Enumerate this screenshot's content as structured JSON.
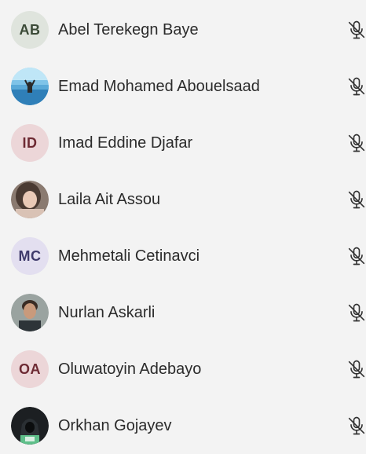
{
  "participants": [
    {
      "name": "Abel Terekegn Baye",
      "initials": "AB",
      "avatar_type": "initials",
      "avatar_bg": "#dfe4dd",
      "avatar_fg": "#3b4a37",
      "mic_state": "muted"
    },
    {
      "name": "Emad Mohamed Abouelsaad",
      "avatar_type": "photo",
      "photo_desc": "beach-photo",
      "mic_state": "muted"
    },
    {
      "name": "Imad Eddine Djafar",
      "initials": "ID",
      "avatar_type": "initials",
      "avatar_bg": "#ecd6d8",
      "avatar_fg": "#6d2a33",
      "mic_state": "muted"
    },
    {
      "name": "Laila Ait Assou",
      "avatar_type": "photo",
      "photo_desc": "portrait-photo",
      "mic_state": "muted"
    },
    {
      "name": "Mehmetali Cetinavci",
      "initials": "MC",
      "avatar_type": "initials",
      "avatar_bg": "#e3dff0",
      "avatar_fg": "#3f3a6b",
      "mic_state": "muted"
    },
    {
      "name": "Nurlan Askarli",
      "avatar_type": "photo",
      "photo_desc": "portrait-photo",
      "mic_state": "muted"
    },
    {
      "name": "Oluwatoyin Adebayo",
      "initials": "OA",
      "avatar_type": "initials",
      "avatar_bg": "#ecd6d8",
      "avatar_fg": "#6d2a33",
      "mic_state": "muted"
    },
    {
      "name": "Orkhan Gojayev",
      "avatar_type": "photo",
      "photo_desc": "hooded-figure-photo",
      "mic_state": "muted"
    }
  ],
  "icons": {
    "mic_muted": "mic-off-icon"
  },
  "colors": {
    "background": "#f3f3f3",
    "text": "#2b2b2b",
    "icon": "#333333"
  }
}
